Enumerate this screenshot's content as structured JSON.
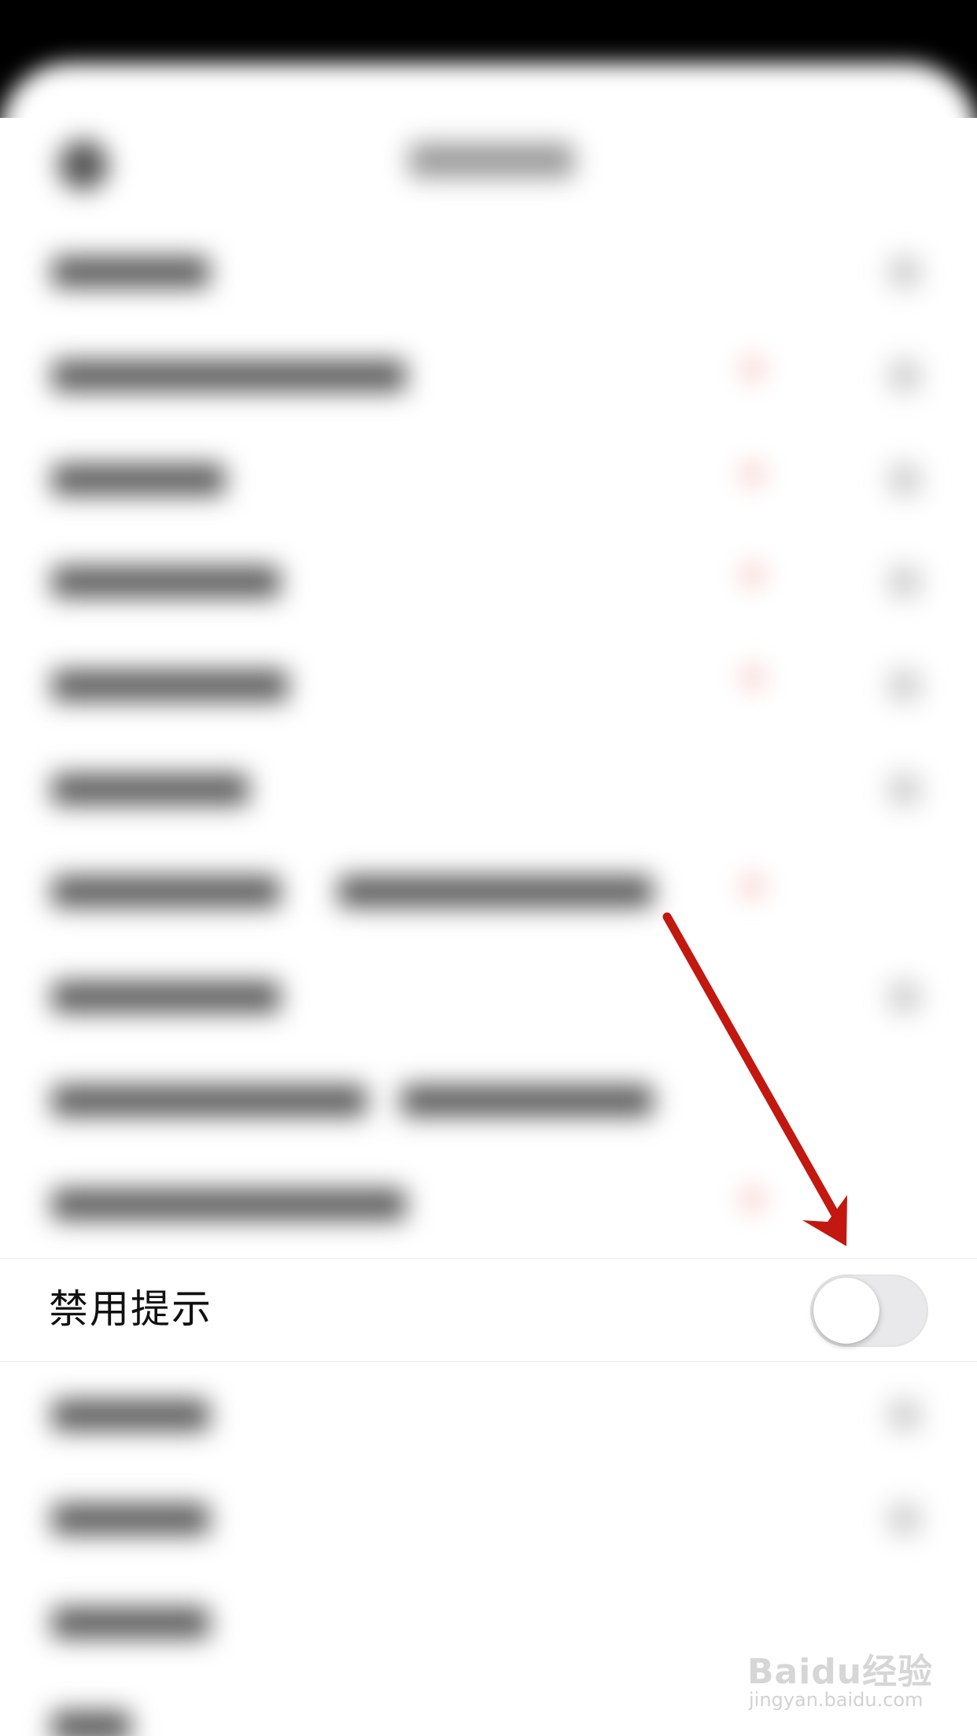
{
  "row": {
    "label": "禁用提示",
    "toggle_on": false
  },
  "watermark": {
    "logo": "Baidu经验",
    "url": "jingyan.baidu.com"
  },
  "colors": {
    "arrow": "#c2180f",
    "toggle_off_bg": "#e9e9eb",
    "label_text": "#111111"
  },
  "icons": {
    "annotation": "arrow-pointing-down-right"
  }
}
